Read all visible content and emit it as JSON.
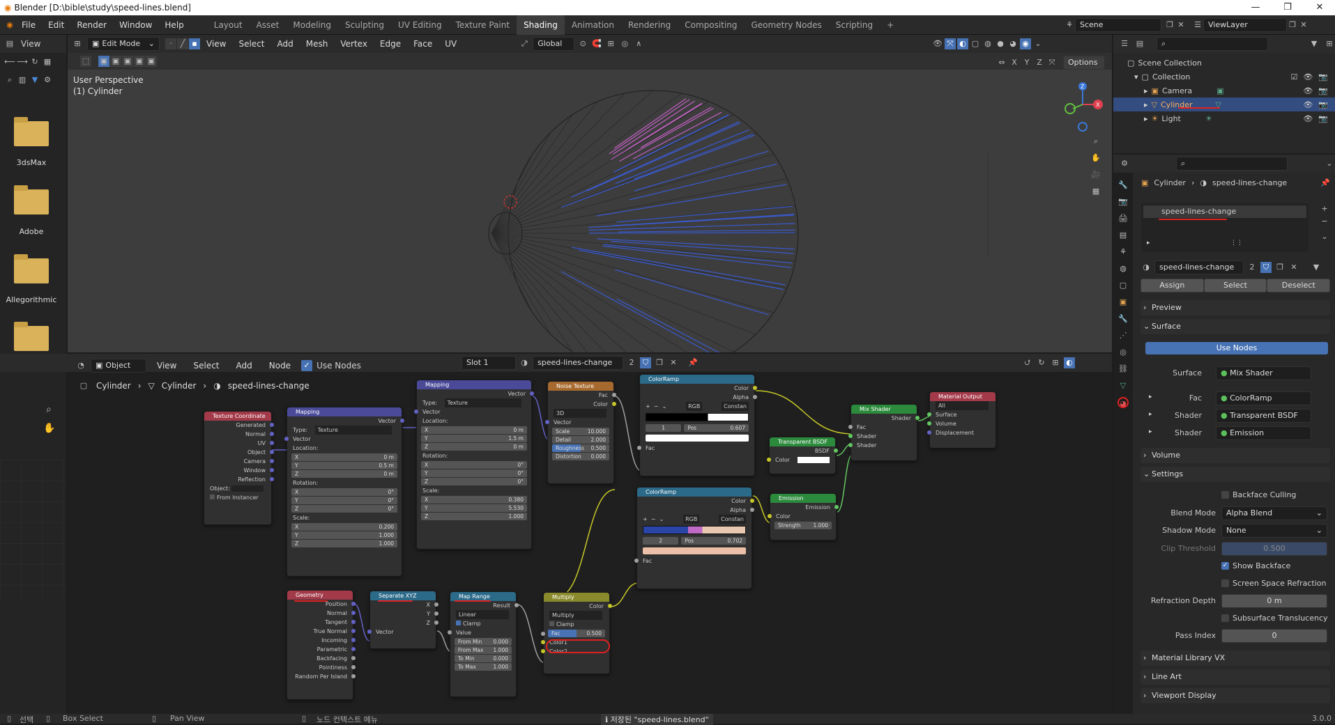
{
  "window": {
    "title": "Blender [D:\\bible\\study\\speed-lines.blend]"
  },
  "topbar": {
    "menus": [
      "File",
      "Edit",
      "Render",
      "Window",
      "Help"
    ],
    "workspaces": [
      "Layout",
      "Asset",
      "Modeling",
      "Sculpting",
      "UV Editing",
      "Texture Paint",
      "Shading",
      "Animation",
      "Rendering",
      "Compositing",
      "Geometry Nodes",
      "Scripting"
    ],
    "active_workspace": "Shading",
    "scene": "Scene",
    "view_layer": "ViewLayer"
  },
  "file_browser": {
    "header_view": "View",
    "folders": [
      "3dsMax",
      "Adobe",
      "Allegorithmic",
      ""
    ]
  },
  "viewport": {
    "mode": "Edit Mode",
    "menus": [
      "View",
      "Select",
      "Add",
      "Mesh",
      "Vertex",
      "Edge",
      "Face",
      "UV"
    ],
    "transform_orientation": "Global",
    "options_label": "Options",
    "overlay_line1": "User Perspective",
    "overlay_line2": "(1) Cylinder",
    "axes": {
      "x": "X",
      "y": "Y",
      "z": "Z"
    }
  },
  "node_editor": {
    "object_mode": "Object",
    "menus": [
      "View",
      "Select",
      "Add",
      "Node"
    ],
    "use_nodes_label": "Use Nodes",
    "slot": "Slot 1",
    "material": "speed-lines-change",
    "material_users": "2",
    "breadcrumb": [
      "Cylinder",
      "Cylinder",
      "speed-lines-change"
    ],
    "nodes": {
      "texcoord": {
        "title": "Texture Coordinate",
        "outputs": [
          "Generated",
          "Normal",
          "UV",
          "Object",
          "Camera",
          "Window",
          "Reflection"
        ],
        "object_label": "Object:",
        "from_instancer": "From Instancer"
      },
      "mapping1": {
        "title": "Mapping",
        "out": "Vector",
        "type_label": "Type:",
        "type": "Texture",
        "in_vector": "Vector",
        "location": "Location:",
        "loc": [
          "0 m",
          "0.5 m",
          "0 m"
        ],
        "rotation": "Rotation:",
        "rot": [
          "0°",
          "0°",
          "0°"
        ],
        "scale": "Scale:",
        "scl": [
          "0.200",
          "1.000",
          "1.000"
        ]
      },
      "mapping2": {
        "title": "Mapping",
        "out": "Vector",
        "type_label": "Type:",
        "type": "Texture",
        "in_vector": "Vector",
        "location": "Location:",
        "loc": [
          "0 m",
          "1.5 m",
          "0 m"
        ],
        "rotation": "Rotation:",
        "rot": [
          "0°",
          "0°",
          "0°"
        ],
        "scale": "Scale:",
        "scl": [
          "0.380",
          "5.530",
          "1.000"
        ]
      },
      "noise": {
        "title": "Noise Texture",
        "outputs": [
          "Fac",
          "Color"
        ],
        "dim": "3D",
        "in_vector": "Vector",
        "fields": [
          [
            "Scale",
            "10.000"
          ],
          [
            "Detail",
            "2.000"
          ],
          [
            "Roughness",
            "0.500"
          ],
          [
            "Distortion",
            "0.000"
          ]
        ]
      },
      "ramp1": {
        "title": "ColorRamp",
        "outputs": [
          "Color",
          "Alpha"
        ],
        "mode": "RGB",
        "interp": "Constan",
        "index": "1",
        "pos_label": "Pos",
        "pos": "0.607",
        "in": "Fac"
      },
      "ramp2": {
        "title": "ColorRamp",
        "outputs": [
          "Color",
          "Alpha"
        ],
        "mode": "RGB",
        "interp": "Constan",
        "index": "2",
        "pos_label": "Pos",
        "pos": "0.702",
        "in": "Fac"
      },
      "transparent": {
        "title": "Transparent BSDF",
        "out": "BSDF",
        "in": "Color"
      },
      "emission": {
        "title": "Emission",
        "out": "Emission",
        "in_color": "Color",
        "strength": "Strength",
        "strength_val": "1.000"
      },
      "mix": {
        "title": "Mix Shader",
        "out": "Shader",
        "inputs": [
          "Fac",
          "Shader",
          "Shader"
        ]
      },
      "output": {
        "title": "Material Output",
        "target": "All",
        "inputs": [
          "Surface",
          "Volume",
          "Displacement"
        ]
      },
      "geometry": {
        "title": "Geometry",
        "outputs": [
          "Position",
          "Normal",
          "Tangent",
          "True Normal",
          "Incoming",
          "Parametric",
          "Backfacing",
          "Pointiness",
          "Random Per Island"
        ]
      },
      "sepxyz": {
        "title": "Separate XYZ",
        "outputs": [
          "X",
          "Y",
          "Z"
        ],
        "in": "Vector"
      },
      "maprange": {
        "title": "Map Range",
        "out": "Result",
        "interp": "Linear",
        "clamp": "Clamp",
        "in": "Value",
        "fields": [
          [
            "From Min",
            "0.000"
          ],
          [
            "From Max",
            "1.000"
          ],
          [
            "To Min",
            "0.000"
          ],
          [
            "To Max",
            "1.000"
          ]
        ]
      },
      "multiply": {
        "title": "Multiply",
        "out": "Color",
        "blend": "Multiply",
        "clamp": "Clamp",
        "fac_label": "Fac",
        "fac": "0.500",
        "inputs": [
          "Color1",
          "Color2"
        ]
      }
    }
  },
  "outliner": {
    "root": "Scene Collection",
    "collection": "Collection",
    "items": [
      "Camera",
      "Cylinder",
      "Light"
    ],
    "selected": "Cylinder"
  },
  "properties": {
    "breadcrumb_object": "Cylinder",
    "breadcrumb_material": "speed-lines-change",
    "slot_item": "speed-lines-change",
    "material_name": "speed-lines-change",
    "material_users": "2",
    "assign": "Assign",
    "select": "Select",
    "deselect": "Deselect",
    "preview": "Preview",
    "surface": "Surface",
    "use_nodes": "Use Nodes",
    "surface_rows": [
      {
        "label": "Surface",
        "value": "Mix Shader"
      },
      {
        "label": "Fac",
        "value": "ColorRamp"
      },
      {
        "label": "Shader",
        "value": "Transparent BSDF"
      },
      {
        "label": "Shader",
        "value": "Emission"
      }
    ],
    "volume": "Volume",
    "settings": "Settings",
    "backface_culling": "Backface Culling",
    "blend_mode_label": "Blend Mode",
    "blend_mode": "Alpha Blend",
    "shadow_mode_label": "Shadow Mode",
    "shadow_mode": "None",
    "clip_threshold_label": "Clip Threshold",
    "clip_threshold": "0.500",
    "show_backface": "Show Backface",
    "screen_space_refraction": "Screen Space Refraction",
    "refraction_depth_label": "Refraction Depth",
    "refraction_depth": "0 m",
    "subsurface_translucency": "Subsurface Translucency",
    "pass_index_label": "Pass Index",
    "pass_index": "0",
    "collapsed": [
      "Material Library VX",
      "Line Art",
      "Viewport Display"
    ]
  },
  "statusbar": {
    "select": "선택",
    "box_select": "Box Select",
    "pan_view": "Pan View",
    "context_menu": "노드 컨텍스트 메뉴",
    "message": "저장된 \"speed-lines.blend\"",
    "version": "3.0.0"
  },
  "colors": {
    "accent_blue": "#4772b3",
    "annotation_red": "#e02020",
    "shader_green": "#2c8a3c",
    "texture_orange": "#a66a2e",
    "converter_blue": "#2c6a8a",
    "input_red": "#a33a4a",
    "vector_purple": "#4a4a99"
  }
}
